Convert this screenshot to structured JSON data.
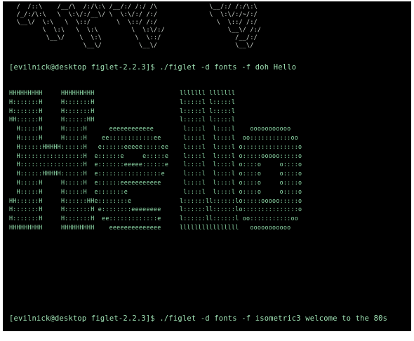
{
  "terminal": {
    "art_top": "  /  /::\\    /__/\\  /:/\\:\\ /__/:/ /:/ /\\              \\__/:/ /:/\\:\\\n  /_/:/\\:\\   \\  \\:\\/:/__\\/ \\  \\:\\/:/ /:/              \\  \\:\\/:/~/:/\n  \\__\\/  \\:\\   \\  \\::/       \\  \\::/ /:/                \\  \\::/ /:/\n         \\  \\:\\   \\  \\:\\         \\  \\:\\/:/                 \\__\\/ /:/\n          \\__\\/    \\  \\:\\         \\  \\::/                    /__/:/\n                    \\__\\/          \\__\\/                     \\__\\/",
    "prompt1": "[evilnick@desktop figlet-2.2.3]$ ./figlet -d fonts -f doh Hello",
    "hello_art": "HHHHHHHHH     HHHHHHHHH                       lllllll lllllll\nH:::::::H     H:::::::H                       l:::::l l:::::l\nH:::::::H     H:::::::H                       l:::::l l:::::l\nHH::::::H     H::::::HH                       l:::::l l:::::l\n  H:::::H     H:::::H      eeeeeeeeeeee        l::::l  l::::l    ooooooooooo\n  H:::::H     H:::::H    ee::::::::::::ee      l::::l  l::::l  oo:::::::::::oo\n  H::::::HHHHH::::::H   e::::::eeeee:::::ee    l::::l  l::::l o:::::::::::::::o\n  H:::::::::::::::::H  e::::::e     e:::::e    l::::l  l::::l o:::::ooooo:::::o\n  H:::::::::::::::::H  e:::::::eeeee::::::e    l::::l  l::::l o::::o     o::::o\n  H::::::HHHHH::::::H  e:::::::::::::::::e     l::::l  l::::l o::::o     o::::o\n  H:::::H     H:::::H  e::::::eeeeeeeeeee      l::::l  l::::l o::::o     o::::o\n  H:::::H     H:::::H  e:::::::e               l::::l  l::::l o::::o     o::::o\nHH::::::H     H::::::HHe::::::::e             l::::::ll::::::lo:::::ooooo:::::o\nH:::::::H     H:::::::H e::::::::eeeeeeee     l::::::ll::::::lo:::::::::::::::o\nH:::::::H     H:::::::H  ee:::::::::::::e     l::::::ll::::::l oo:::::::::::oo\nHHHHHHHHH     HHHHHHHHH    eeeeeeeeeeeeee     llllllllllllllll   ooooooooooo",
    "prompt2": "[evilnick@desktop figlet-2.2.3]$ ./figlet -d fonts -f isometric3 welcome to the 80s"
  }
}
